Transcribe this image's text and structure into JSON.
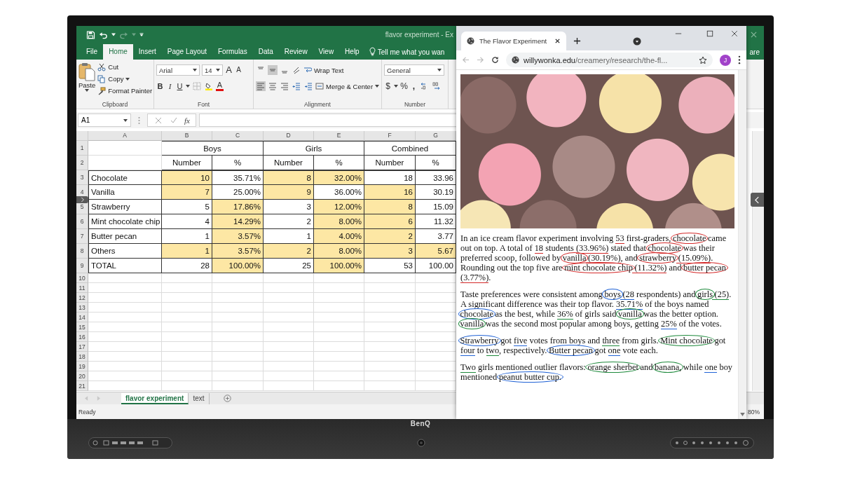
{
  "excel": {
    "title": "flavor experiment - Ex",
    "ribbon_tabs": [
      {
        "label": "File",
        "selected": false
      },
      {
        "label": "Home",
        "selected": true
      },
      {
        "label": "Insert",
        "selected": false
      },
      {
        "label": "Page Layout",
        "selected": false
      },
      {
        "label": "Formulas",
        "selected": false
      },
      {
        "label": "Data",
        "selected": false
      },
      {
        "label": "Review",
        "selected": false
      },
      {
        "label": "View",
        "selected": false
      },
      {
        "label": "Help",
        "selected": false
      }
    ],
    "tell_me": "Tell me what you wan",
    "share_partial": "are",
    "clipboard": {
      "paste": "Paste",
      "cut": "Cut",
      "copy": "Copy",
      "format_painter": "Format Painter",
      "label": "Clipboard"
    },
    "font": {
      "name": "Arial",
      "size": "14",
      "grow": "A",
      "shrink": "A",
      "bold": "B",
      "italic": "I",
      "underline": "U",
      "font_color": "A",
      "label": "Font"
    },
    "alignment": {
      "wrap_text": "Wrap Text",
      "merge_center": "Merge & Center",
      "label": "Alignment"
    },
    "number": {
      "format": "General",
      "currency": "$",
      "percent": "%",
      "comma": ",",
      "label": "Number"
    },
    "name_box": "A1",
    "fx": "fx",
    "columns": [
      "A",
      "B",
      "C",
      "D",
      "E",
      "F",
      "G"
    ],
    "row_numbers": [
      "1",
      "2",
      "3",
      "4",
      "5",
      "6",
      "7",
      "8",
      "9",
      "10",
      "11",
      "12",
      "13",
      "14",
      "15",
      "16",
      "17",
      "18",
      "19",
      "20",
      "21"
    ],
    "group_headers": [
      {
        "label": "Boys"
      },
      {
        "label": "Girls"
      },
      {
        "label": "Combined"
      }
    ],
    "sub_headers": [
      "Number",
      "%",
      "Number",
      "%",
      "Number",
      "%"
    ],
    "rows": [
      {
        "cells": [
          {
            "text": "Chocolate",
            "highlighted": false
          },
          {
            "text": "10",
            "highlighted": true
          },
          {
            "text": "35.71%",
            "highlighted": false
          },
          {
            "text": "8",
            "highlighted": true
          },
          {
            "text": "32.00%",
            "highlighted": true
          },
          {
            "text": "18",
            "highlighted": false
          },
          {
            "text": "33.96",
            "highlighted": false
          }
        ]
      },
      {
        "cells": [
          {
            "text": "Vanilla",
            "highlighted": false
          },
          {
            "text": "7",
            "highlighted": true
          },
          {
            "text": "25.00%",
            "highlighted": false
          },
          {
            "text": "9",
            "highlighted": true
          },
          {
            "text": "36.00%",
            "highlighted": false
          },
          {
            "text": "16",
            "highlighted": true
          },
          {
            "text": "30.19",
            "highlighted": false
          }
        ]
      },
      {
        "cells": [
          {
            "text": "Strawberry",
            "highlighted": false
          },
          {
            "text": "5",
            "highlighted": false
          },
          {
            "text": "17.86%",
            "highlighted": true
          },
          {
            "text": "3",
            "highlighted": false
          },
          {
            "text": "12.00%",
            "highlighted": true
          },
          {
            "text": "8",
            "highlighted": true
          },
          {
            "text": "15.09",
            "highlighted": false
          }
        ]
      },
      {
        "cells": [
          {
            "text": "Mint chocolate chip",
            "highlighted": false
          },
          {
            "text": "4",
            "highlighted": false
          },
          {
            "text": "14.29%",
            "highlighted": true
          },
          {
            "text": "2",
            "highlighted": false
          },
          {
            "text": "8.00%",
            "highlighted": true
          },
          {
            "text": "6",
            "highlighted": true
          },
          {
            "text": "11.32",
            "highlighted": false
          }
        ]
      },
      {
        "cells": [
          {
            "text": "Butter pecan",
            "highlighted": false
          },
          {
            "text": "1",
            "highlighted": false
          },
          {
            "text": "3.57%",
            "highlighted": true
          },
          {
            "text": "1",
            "highlighted": false
          },
          {
            "text": "4.00%",
            "highlighted": true
          },
          {
            "text": "2",
            "highlighted": true
          },
          {
            "text": "3.77",
            "highlighted": false
          }
        ]
      },
      {
        "cells": [
          {
            "text": "Others",
            "highlighted": false
          },
          {
            "text": "1",
            "highlighted": true
          },
          {
            "text": "3.57%",
            "highlighted": true
          },
          {
            "text": "2",
            "highlighted": true
          },
          {
            "text": "8.00%",
            "highlighted": true
          },
          {
            "text": "3",
            "highlighted": true
          },
          {
            "text": "5.67",
            "highlighted": true
          }
        ]
      },
      {
        "cells": [
          {
            "text": "TOTAL",
            "highlighted": false
          },
          {
            "text": "28",
            "highlighted": false
          },
          {
            "text": "100.00%",
            "highlighted": true
          },
          {
            "text": "25",
            "highlighted": false
          },
          {
            "text": "100.00%",
            "highlighted": true
          },
          {
            "text": "53",
            "highlighted": false
          },
          {
            "text": "100.00",
            "highlighted": false
          }
        ]
      }
    ],
    "sheet_tabs": [
      {
        "label": "flavor experiment",
        "selected": true
      },
      {
        "label": "text",
        "selected": false
      }
    ],
    "status": "Ready",
    "zoom": "80%"
  },
  "browser": {
    "tab_title": "The Flavor Experiment",
    "url_host": "willywonka.edu",
    "url_path": "/creamery/research/the-fl...",
    "avatar": "J",
    "paragraphs": [
      {
        "segments": [
          {
            "text": "In an ice cream flavor experiment involving "
          },
          {
            "text": "53",
            "kind": "underline",
            "color": "#d42a2a"
          },
          {
            "text": " first-graders, "
          },
          {
            "text": "chocolate",
            "kind": "circle",
            "color": "#d42a2a"
          },
          {
            "text": " came out on top. A total of "
          },
          {
            "text": "18",
            "kind": "underline",
            "color": "#d42a2a"
          },
          {
            "text": " students "
          },
          {
            "text": "(33.96%)",
            "kind": "underline",
            "color": "#d42a2a"
          },
          {
            "text": " stated that "
          },
          {
            "text": "chocolate",
            "kind": "circle",
            "color": "#d42a2a"
          },
          {
            "text": " was their preferred scoop, followed by "
          },
          {
            "text": "vanilla",
            "kind": "circle",
            "color": "#d42a2a"
          },
          {
            "text": " (30.19%)",
            "kind": "underline",
            "color": "#d42a2a"
          },
          {
            "text": ", and "
          },
          {
            "text": "strawberry",
            "kind": "circle",
            "color": "#d42a2a"
          },
          {
            "text": " (15.09%)",
            "kind": "underline",
            "color": "#d42a2a"
          },
          {
            "text": ". Rounding out the top five are "
          },
          {
            "text": "mint chocolate chip",
            "kind": "circle",
            "color": "#d42a2a"
          },
          {
            "text": " (11.32%)",
            "kind": "underline",
            "color": "#d42a2a"
          },
          {
            "text": " and "
          },
          {
            "text": "butter pecan",
            "kind": "circle",
            "color": "#d42a2a"
          },
          {
            "text": " (3.77%)",
            "kind": "underline",
            "color": "#d42a2a"
          },
          {
            "text": "."
          }
        ]
      },
      {
        "segments": [
          {
            "text": "Taste preferences were consistent among "
          },
          {
            "text": "boys",
            "kind": "circle",
            "color": "#2163d6"
          },
          {
            "text": " (28",
            "kind": "underline",
            "color": "#2163d6"
          },
          {
            "text": " respondents) and "
          },
          {
            "text": "girls",
            "kind": "circle",
            "color": "#1e8a3c"
          },
          {
            "text": " (25)",
            "kind": "underline",
            "color": "#1e8a3c"
          },
          {
            "text": ". A significant difference was their top flavor. "
          },
          {
            "text": "35.71%",
            "kind": "underline",
            "color": "#2163d6"
          },
          {
            "text": " of the boys named "
          },
          {
            "text": "chocolate",
            "kind": "circle",
            "color": "#2163d6"
          },
          {
            "text": " as the best, while "
          },
          {
            "text": "36%",
            "kind": "underline",
            "color": "#1e8a3c"
          },
          {
            "text": " of girls said "
          },
          {
            "text": "vanilla",
            "kind": "circle",
            "color": "#1e8a3c"
          },
          {
            "text": " was the better option. "
          },
          {
            "text": "vanilla",
            "kind": "circle",
            "color": "#1e8a3c"
          },
          {
            "text": " was the second most popular among boys, getting "
          },
          {
            "text": "25%",
            "kind": "underline",
            "color": "#2163d6"
          },
          {
            "text": " of the votes."
          }
        ]
      },
      {
        "segments": [
          {
            "text": "Strawberry",
            "kind": "circle",
            "color": "#2163d6"
          },
          {
            "text": " got "
          },
          {
            "text": "five",
            "kind": "underline",
            "color": "#2163d6"
          },
          {
            "text": " votes from boys and "
          },
          {
            "text": "three",
            "kind": "underline",
            "color": "#1e8a3c"
          },
          {
            "text": " from girls. "
          },
          {
            "text": "Mint chocolate",
            "kind": "circle",
            "color": "#1e8a3c"
          },
          {
            "text": " got "
          },
          {
            "text": "four",
            "kind": "underline",
            "color": "#2163d6"
          },
          {
            "text": " to "
          },
          {
            "text": "two",
            "kind": "underline",
            "color": "#1e8a3c"
          },
          {
            "text": ", respectively. "
          },
          {
            "text": "Butter pecan",
            "kind": "circle",
            "color": "#2163d6"
          },
          {
            "text": " got "
          },
          {
            "text": "one",
            "kind": "underline",
            "color": "#2163d6"
          },
          {
            "text": " vote each."
          }
        ]
      },
      {
        "segments": [
          {
            "text": "Two",
            "kind": "underline",
            "color": "#1e8a3c"
          },
          {
            "text": " girls mentioned outlier flavors: "
          },
          {
            "text": "orange sherbet",
            "kind": "circle",
            "color": "#1e8a3c"
          },
          {
            "text": " and "
          },
          {
            "text": "banana,",
            "kind": "circle",
            "color": "#1e8a3c"
          },
          {
            "text": " while "
          },
          {
            "text": "one",
            "kind": "underline",
            "color": "#2163d6"
          },
          {
            "text": " boy mentioned "
          },
          {
            "text": "peanut butter cup.",
            "kind": "circle",
            "color": "#2163d6"
          }
        ]
      }
    ]
  },
  "monitor": {
    "brand": "BenQ"
  }
}
